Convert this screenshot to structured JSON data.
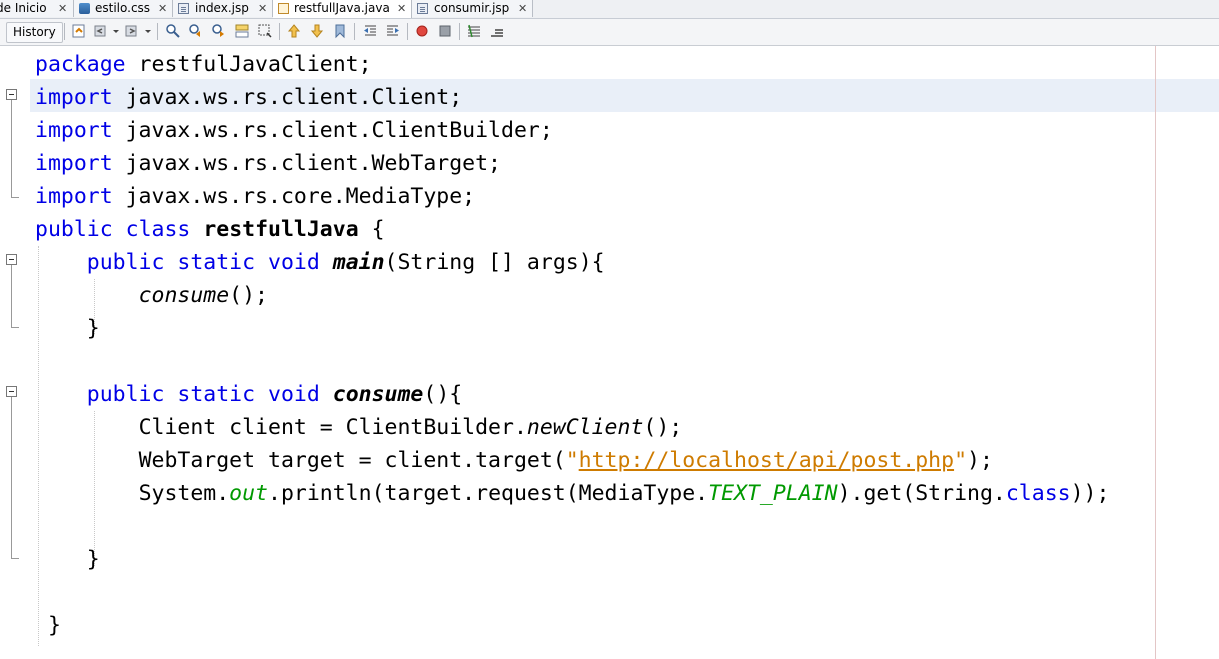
{
  "tabs": [
    {
      "label": "de Inicio",
      "close": "✕",
      "icon": "start-page-icon",
      "active": false
    },
    {
      "label": "estilo.css",
      "close": "✕",
      "icon": "css-file-icon",
      "active": false
    },
    {
      "label": "index.jsp",
      "close": "✕",
      "icon": "jsp-file-icon",
      "active": false
    },
    {
      "label": "restfullJava.java",
      "close": "✕",
      "icon": "java-file-icon",
      "active": true
    },
    {
      "label": "consumir.jsp",
      "close": "✕",
      "icon": "jsp-file-icon",
      "active": false
    }
  ],
  "toolbar": {
    "history_label": "History",
    "icons": [
      "last-edit-icon",
      "back-icon",
      "forward-icon",
      "find-icon",
      "find-previous-icon",
      "find-next-icon",
      "toggle-highlight-icon",
      "select-rect-icon",
      "prev-bookmark-icon",
      "next-bookmark-icon",
      "toggle-bookmark-icon",
      "shift-left-icon",
      "shift-right-icon",
      "record-macro-icon",
      "stop-macro-icon",
      "comment-icon",
      "uncomment-icon"
    ]
  },
  "code": {
    "l1": {
      "kw": "package",
      "rest": " restfulJavaClient;"
    },
    "l2": {
      "kw": "import",
      "rest": " javax.ws.rs.client.Client;"
    },
    "l3": {
      "kw": "import",
      "rest": " javax.ws.rs.client.ClientBuilder;"
    },
    "l4": {
      "kw": "import",
      "rest": " javax.ws.rs.client.WebTarget;"
    },
    "l5": {
      "kw": "import",
      "rest": " javax.ws.rs.core.MediaType;"
    },
    "l6": {
      "kw1": "public",
      "kw2": "class",
      "name": "restfullJava",
      "rest": " {"
    },
    "l7": {
      "kw1": "public",
      "kw2": "static",
      "kw3": "void",
      "name": "main",
      "rest": "(String [] args){"
    },
    "l8": {
      "call": "consume",
      "rest": "();"
    },
    "l9": {
      "text": "}"
    },
    "l11": {
      "kw1": "public",
      "kw2": "static",
      "kw3": "void",
      "name": "consume",
      "rest": "(){"
    },
    "l12": {
      "a": "Client client = ClientBuilder.",
      "call": "newClient",
      "b": "();"
    },
    "l13": {
      "a": "WebTarget target = client.target(",
      "q1": "\"",
      "url": "http://localhost/api/post.php",
      "q2": "\"",
      "b": ");"
    },
    "l14": {
      "a": "System.",
      "out": "out",
      "b": ".println(target.request(MediaType.",
      "field": "TEXT_PLAIN",
      "c": ").get(String.",
      "kw": "class",
      "d": "));"
    },
    "l16": {
      "text": "}"
    },
    "l18": {
      "text": "}"
    }
  },
  "colors": {
    "keyword": "#0000e6",
    "string": "#ce7b00",
    "field": "#009900",
    "current_line": "#e9eff8"
  }
}
